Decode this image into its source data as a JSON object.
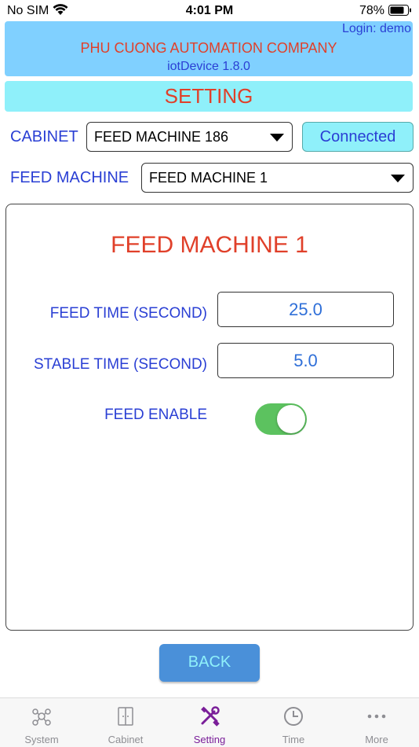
{
  "status_bar": {
    "carrier": "No SIM",
    "time": "4:01 PM",
    "battery": "78%"
  },
  "header": {
    "login": "Login: demo",
    "company": "PHU CUONG AUTOMATION COMPANY",
    "version": "iotDevice 1.8.0"
  },
  "page_title": "SETTING",
  "cabinet": {
    "label": "CABINET",
    "selected": "FEED MACHINE 186",
    "status": "Connected"
  },
  "feed_machine": {
    "label": "FEED MACHINE",
    "selected": "FEED MACHINE 1"
  },
  "panel": {
    "title": "FEED MACHINE 1",
    "feed_time_label": "FEED TIME (SECOND)",
    "feed_time_value": "25.0",
    "stable_time_label": "STABLE TIME (SECOND)",
    "stable_time_value": "5.0",
    "feed_enable_label": "FEED ENABLE",
    "feed_enable_on": true
  },
  "back_label": "BACK",
  "tabs": [
    {
      "label": "System",
      "icon": "network-icon",
      "active": false
    },
    {
      "label": "Cabinet",
      "icon": "cabinet-icon",
      "active": false
    },
    {
      "label": "Setting",
      "icon": "tools-icon",
      "active": true
    },
    {
      "label": "Time",
      "icon": "clock-icon",
      "active": false
    },
    {
      "label": "More",
      "icon": "more-icon",
      "active": false
    }
  ],
  "colors": {
    "accent_red": "#e0402a",
    "accent_blue": "#2a3fd4",
    "header_bg": "#80d0ff",
    "cyan": "#8ff0fa",
    "toggle_on": "#5cc25f",
    "tab_active": "#7a1e99"
  }
}
